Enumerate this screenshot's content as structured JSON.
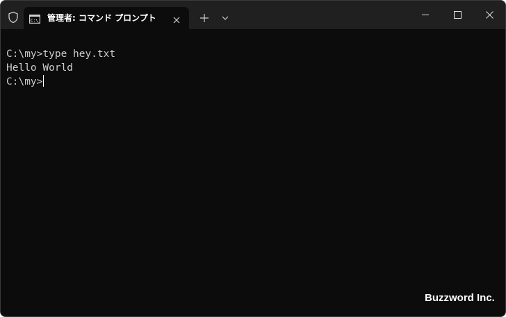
{
  "tab": {
    "title": "管理者: コマンド プロンプト",
    "icon": "console-app-icon"
  },
  "titlebar_icons": {
    "shield": "shield-icon",
    "new_tab": "plus-icon",
    "dropdown": "chevron-down-icon",
    "minimize": "minimize-icon",
    "maximize": "maximize-icon",
    "close": "close-icon"
  },
  "console": {
    "lines": [
      "C:\\my>type hey.txt",
      "Hello World"
    ],
    "prompt": "C:\\my>"
  },
  "watermark": "Buzzword Inc.",
  "colors": {
    "titlebar_bg": "#202020",
    "terminal_bg": "#0c0c0c",
    "text": "#cccccc"
  }
}
